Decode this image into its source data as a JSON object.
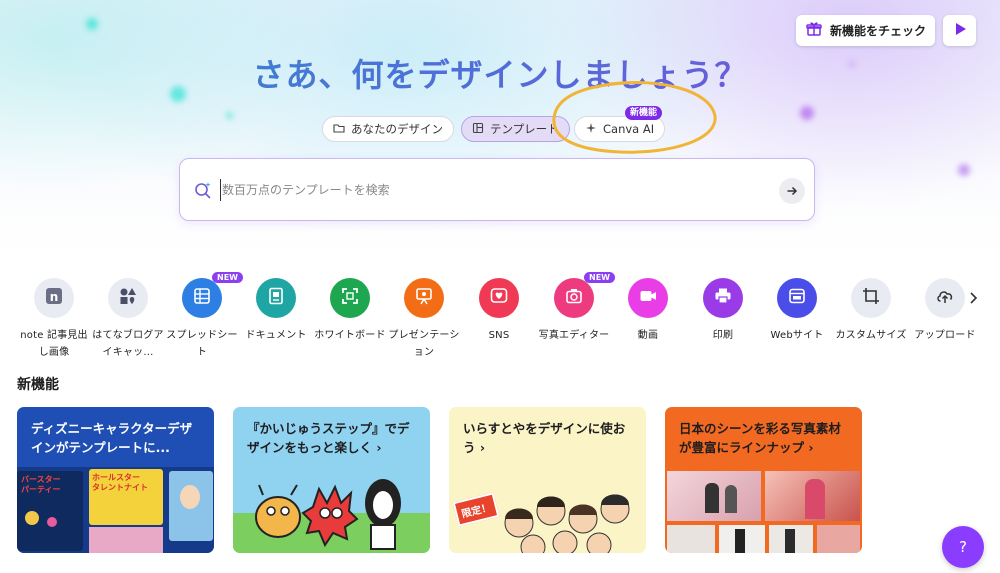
{
  "header": {
    "new_features_button": "新機能をチェック",
    "headline": "さあ、何をデザインしましょう？"
  },
  "tabs": [
    {
      "label": "あなたのデザイン",
      "icon": "folder-icon"
    },
    {
      "label": "テンプレート",
      "icon": "template-icon",
      "active": true
    },
    {
      "label": "Canva AI",
      "icon": "sparkle-icon",
      "badge": "新機能"
    }
  ],
  "search": {
    "placeholder": "数百万点のテンプレートを検索"
  },
  "categories": [
    {
      "label": "note 記事見出し画像",
      "icon": "note-icon",
      "color": "#e8eaf0"
    },
    {
      "label": "はてなブログアイキャッ...",
      "icon": "shapes-icon",
      "color": "#e8eaf0"
    },
    {
      "label": "スプレッドシート",
      "icon": "spreadsheet-icon",
      "color": "#2d7fe3",
      "badge": "NEW"
    },
    {
      "label": "ドキュメント",
      "icon": "document-icon",
      "color": "#1fa5a3"
    },
    {
      "label": "ホワイトボード",
      "icon": "whiteboard-icon",
      "color": "#1ea650"
    },
    {
      "label": "プレゼンテーション",
      "icon": "presentation-icon",
      "color": "#f26d16"
    },
    {
      "label": "SNS",
      "icon": "heart-icon",
      "color": "#f03a55"
    },
    {
      "label": "写真エディター",
      "icon": "camera-icon",
      "color": "#ee3a7f",
      "badge": "NEW"
    },
    {
      "label": "動画",
      "icon": "video-icon",
      "color": "#e93de6"
    },
    {
      "label": "印刷",
      "icon": "printer-icon",
      "color": "#9a3be8"
    },
    {
      "label": "Webサイト",
      "icon": "website-icon",
      "color": "#4a4de8"
    },
    {
      "label": "カスタムサイズ",
      "icon": "crop-icon",
      "color": "#e8eaf0"
    },
    {
      "label": "アップロード",
      "icon": "upload-icon",
      "color": "#e8eaf0"
    }
  ],
  "section": {
    "title": "新機能"
  },
  "cards": [
    {
      "title": "ディズニーキャラクターデザインがテンプレートに...",
      "bg": "#1f4fb5",
      "color": "#ffffff"
    },
    {
      "title": "『かいじゅうステップ』でデザインをもっと楽しく ›",
      "bg": "#8fd3f0",
      "color": "#1d1d1f"
    },
    {
      "title": "いらすとやをデザインに使おう ›",
      "bg": "#fbf4c7",
      "color": "#1d1d1f"
    },
    {
      "title": "日本のシーンを彩る写真素材が豊富にラインナップ ›",
      "bg": "#f26a21",
      "color": "#1d1d1f"
    }
  ],
  "card_art": {
    "disney_1": "バースター\nパーティー",
    "disney_2": "ホールスター\nタレントナイト",
    "kaiju_stamp": "限定！"
  },
  "help": {
    "label": "?"
  }
}
